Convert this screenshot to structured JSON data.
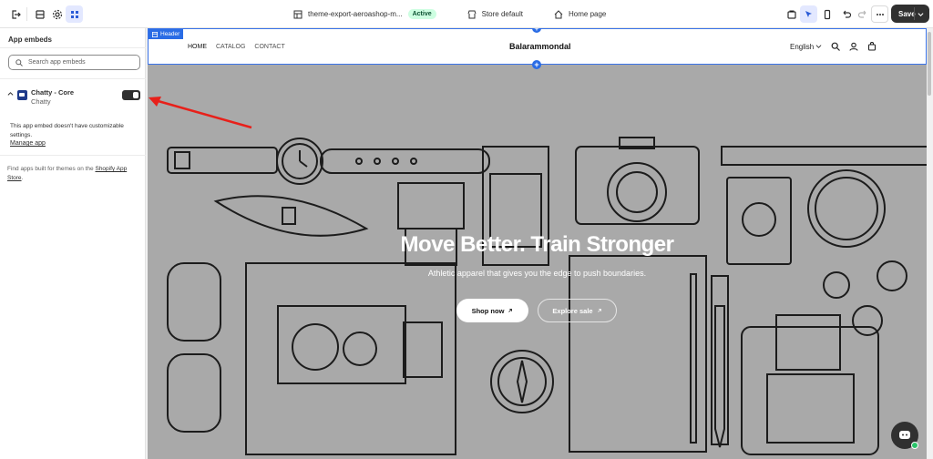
{
  "topbar": {
    "theme_name": "theme-export-aeroashop-m...",
    "status_badge": "Active",
    "store_selector": "Store default",
    "page_selector": "Home page",
    "save_label": "Save",
    "icons": [
      "exit-icon",
      "sections-icon",
      "settings-icon",
      "app-embeds-icon",
      "theme-icon",
      "inspector-icon",
      "mobile-icon",
      "undo-icon",
      "redo-icon",
      "more-icon"
    ]
  },
  "sidebar": {
    "title": "App embeds",
    "search_placeholder": "Search app embeds",
    "embed": {
      "name": "Chatty - Core",
      "provider": "Chatty",
      "enabled": true
    },
    "note": "This app embed doesn't have customizable settings.",
    "manage_link": "Manage app",
    "find_text": "Find apps built for themes on the",
    "find_link": "Shopify App Store",
    "find_end": "."
  },
  "preview": {
    "header_tag": "Header",
    "nav": [
      "HOME",
      "CATALOG",
      "CONTACT"
    ],
    "brand": "Balarammondal",
    "language": "English",
    "hero_title": "Move Better. Train Stronger",
    "hero_subtitle": "Athletic apparel that gives you the edge to push boundaries.",
    "shop_button": "Shop now",
    "sale_button": "Explore sale"
  },
  "colors": {
    "accent": "#2a6ce5",
    "hero_bg": "#a9a9a9",
    "badge_bg": "#cdfee1",
    "annotation_arrow": "#e8201a"
  }
}
